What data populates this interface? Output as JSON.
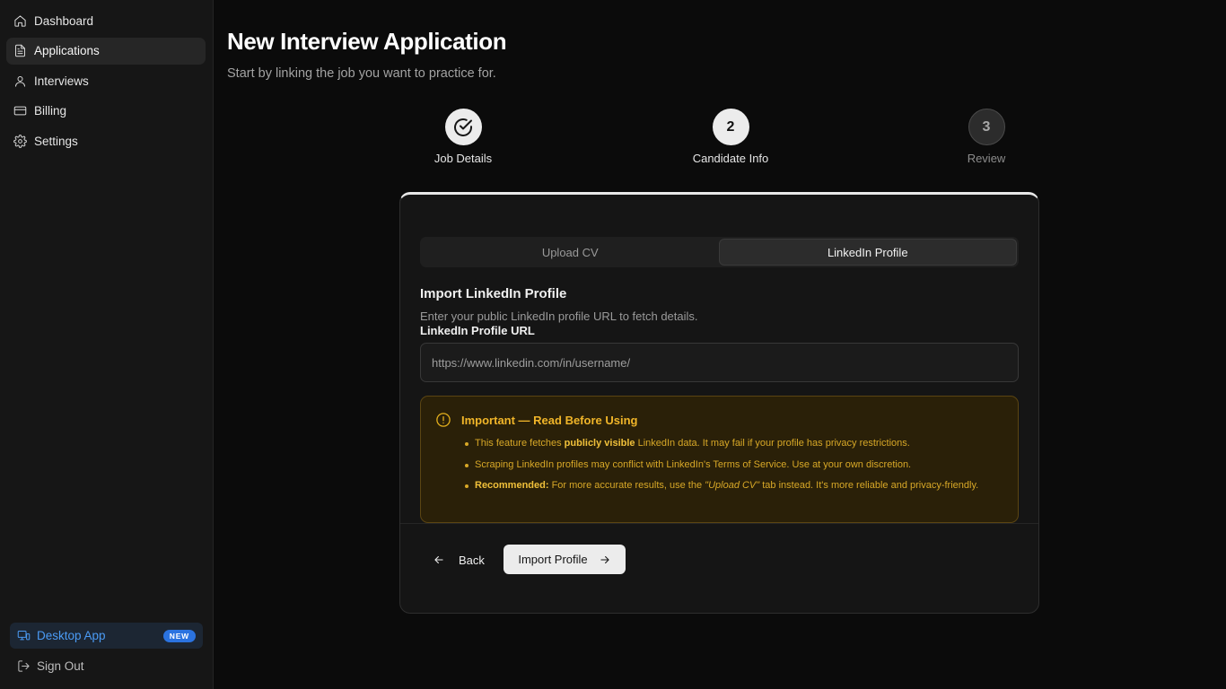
{
  "sidebar": {
    "items": [
      {
        "label": "Dashboard",
        "icon": "home-icon"
      },
      {
        "label": "Applications",
        "icon": "document-icon",
        "active": true
      },
      {
        "label": "Interviews",
        "icon": "user-icon"
      },
      {
        "label": "Billing",
        "icon": "credit-card-icon"
      },
      {
        "label": "Settings",
        "icon": "gear-icon"
      }
    ],
    "desktop_app": {
      "label": "Desktop App",
      "badge": "NEW",
      "icon": "monitor-icon"
    },
    "sign_out": {
      "label": "Sign Out",
      "icon": "sign-out-icon"
    }
  },
  "header": {
    "title": "New Interview Application",
    "subtitle": "Start by linking the job you want to practice for."
  },
  "stepper": {
    "steps": [
      {
        "number": "",
        "label": "Job Details",
        "state": "done"
      },
      {
        "number": "2",
        "label": "Candidate Info",
        "state": "current"
      },
      {
        "number": "3",
        "label": "Review",
        "state": "upcoming"
      }
    ]
  },
  "card": {
    "tabs": [
      {
        "label": "Upload CV",
        "active": false
      },
      {
        "label": "LinkedIn Profile",
        "active": true
      }
    ],
    "section_title": "Import LinkedIn Profile",
    "section_desc": "Enter your public LinkedIn profile URL to fetch details.",
    "field_label": "LinkedIn Profile URL",
    "url_placeholder": "https://www.linkedin.com/in/username/",
    "warning": {
      "title": "Important — Read Before Using",
      "b1_pre": "This feature fetches ",
      "b1_bold": "publicly visible",
      "b1_post": " LinkedIn data. It may fail if your profile has privacy restrictions.",
      "b2": "Scraping LinkedIn profiles may conflict with LinkedIn's Terms of Service. Use at your own discretion.",
      "b3_bold": "Recommended:",
      "b3_pre": " For more accurate results, use the ",
      "b3_italic": "\"Upload CV\"",
      "b3_post": " tab instead. It's more reliable and privacy-friendly."
    },
    "back_label": "Back",
    "import_label": "Import Profile"
  },
  "colors": {
    "accent_blue": "#4b9bf5",
    "warning_amber": "#f0b529",
    "background": "#0b0b0b"
  }
}
